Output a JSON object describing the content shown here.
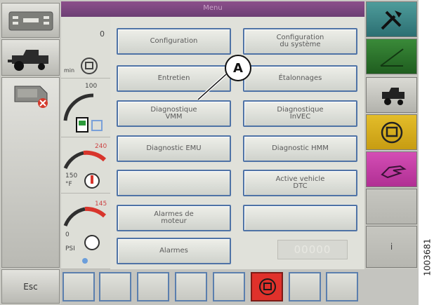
{
  "header": {
    "title": "Menu"
  },
  "gauges": {
    "top_value": "0",
    "top_unit": "min",
    "fuel_max": "100",
    "temp_max": "240",
    "temp_min": "150",
    "temp_unit": "°F",
    "pressure_max": "145",
    "pressure_min": "0",
    "pressure_unit": "PSI"
  },
  "menu": {
    "configuration": "Configuration",
    "configuration_systeme": "Configuration\ndu système",
    "entretien": "Entretien",
    "etalonnages": "Étalonnages",
    "diagnostique_vmm": "Diagnostique\nVMM",
    "diagnostique_invec": "Diagnostique\nInVEC",
    "diagnostic_emu": "Diagnostic EMU",
    "diagnostic_hmm": "Diagnostic HMM",
    "active_vehicle_dtc": "Active vehicle\nDTC",
    "alarmes_moteur": "Alarmes de\nmoteur",
    "alarmes": "Alarmes",
    "counter": "00000"
  },
  "left": {
    "esc_label": "Esc"
  },
  "right": {
    "info_label": "i"
  },
  "callout": {
    "label": "A"
  },
  "figure_ref": "1003681",
  "colors": {
    "title_bar": "#7a4580",
    "button_border": "#4f73a6",
    "engine_alert": "#e0312b",
    "right_green": "#2f7a2f",
    "right_yellow": "#d9b21c",
    "right_magenta": "#c83fa8",
    "right_teal": "#3c8c8c"
  },
  "icons": {
    "left": [
      "radio-toggle-icon",
      "combine-harvester-icon",
      "header-fault-icon"
    ],
    "gauges": [
      "engine-icon",
      "fuel-pump-icon",
      "coolant-temperature-icon",
      "oil-pressure-icon"
    ],
    "right": [
      "tools-icon",
      "slope-icon",
      "combine-icon",
      "engine-icon",
      "hand-icon"
    ],
    "bottom": [
      "engine-alert-icon"
    ]
  }
}
